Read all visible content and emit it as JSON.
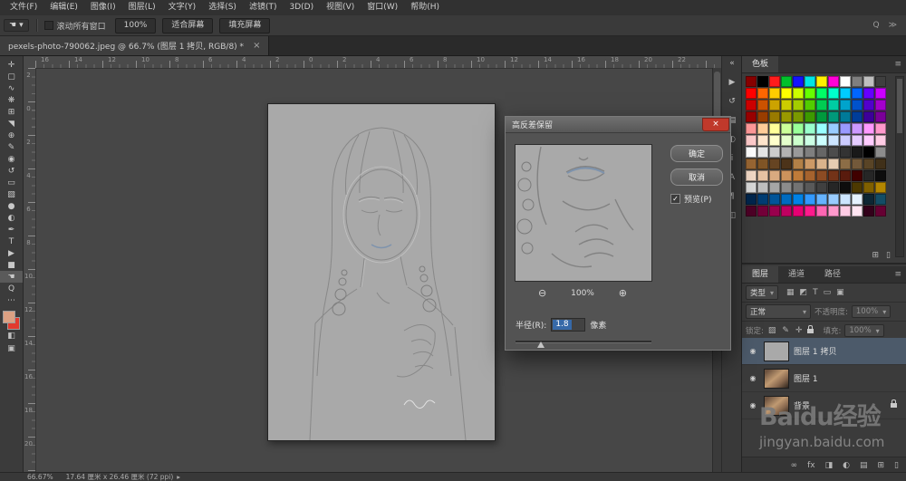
{
  "menu": {
    "items": [
      "文件(F)",
      "编辑(E)",
      "图像(I)",
      "图层(L)",
      "文字(Y)",
      "选择(S)",
      "滤镜(T)",
      "3D(D)",
      "视图(V)",
      "窗口(W)",
      "帮助(H)"
    ]
  },
  "options": {
    "scroll_all_label": "滚动所有窗口",
    "zoom_button": "100%",
    "fit_button": "适合屏幕",
    "fill_button": "填充屏幕"
  },
  "doc_tab": {
    "title": "pexels-photo-790062.jpeg @ 66.7% (图层 1 拷贝, RGB/8) *",
    "close_glyph": "×"
  },
  "tools": [
    {
      "name": "move-tool",
      "glyph": "✛"
    },
    {
      "name": "marquee-tool",
      "glyph": "▢"
    },
    {
      "name": "lasso-tool",
      "glyph": "∿"
    },
    {
      "name": "quick-selection-tool",
      "glyph": "❋"
    },
    {
      "name": "crop-tool",
      "glyph": "⊞"
    },
    {
      "name": "eyedropper-tool",
      "glyph": "◥"
    },
    {
      "name": "healing-brush-tool",
      "glyph": "⊕"
    },
    {
      "name": "brush-tool",
      "glyph": "✎"
    },
    {
      "name": "clone-stamp-tool",
      "glyph": "◉"
    },
    {
      "name": "history-brush-tool",
      "glyph": "↺"
    },
    {
      "name": "eraser-tool",
      "glyph": "▭"
    },
    {
      "name": "gradient-tool",
      "glyph": "▧"
    },
    {
      "name": "blur-tool",
      "glyph": "●"
    },
    {
      "name": "dodge-tool",
      "glyph": "◐"
    },
    {
      "name": "pen-tool",
      "glyph": "✒"
    },
    {
      "name": "type-tool",
      "glyph": "T"
    },
    {
      "name": "path-selection-tool",
      "glyph": "▶"
    },
    {
      "name": "shape-tool",
      "glyph": "■"
    },
    {
      "name": "hand-tool",
      "glyph": "☚",
      "active": true
    },
    {
      "name": "zoom-tool",
      "glyph": "Q"
    },
    {
      "name": "edit-toolbar-button",
      "glyph": "⋯"
    }
  ],
  "toolbar_colors": {
    "foreground": "#dca183",
    "background": "#e23a2e"
  },
  "toolbar_bottom": [
    {
      "name": "quick-mask-button",
      "glyph": "◧"
    },
    {
      "name": "screen-mode-button",
      "glyph": "▣"
    }
  ],
  "ruler": {
    "h_labels": [
      "16",
      "14",
      "12",
      "10",
      "8",
      "6",
      "4",
      "2",
      "0",
      "2",
      "4",
      "6",
      "8",
      "10",
      "12",
      "14",
      "16",
      "18",
      "20",
      "22"
    ],
    "v_labels": [
      "2",
      "0",
      "2",
      "4",
      "6",
      "8",
      "10",
      "12",
      "14",
      "16",
      "18",
      "20"
    ]
  },
  "dock_icons": [
    {
      "name": "dock-collapse-icon",
      "glyph": "«"
    },
    {
      "name": "dock-actions-icon",
      "glyph": "▶"
    },
    {
      "name": "dock-history-icon",
      "glyph": "↺"
    },
    {
      "name": "dock-styles-icon",
      "glyph": "▤"
    },
    {
      "name": "dock-adjustments-icon",
      "glyph": "◐"
    },
    {
      "name": "dock-info-icon",
      "glyph": "i"
    },
    {
      "name": "dock-character-icon",
      "glyph": "A"
    },
    {
      "name": "dock-paragraph-icon",
      "glyph": "¶"
    },
    {
      "name": "dock-clone-source-icon",
      "glyph": "◫"
    }
  ],
  "dialog": {
    "title": "高反差保留",
    "ok": "确定",
    "cancel": "取消",
    "preview_label": "预览(P)",
    "zoom_value": "100%",
    "radius_label": "半径(R):",
    "radius_value": "1.8",
    "radius_unit": "像素"
  },
  "swatches": {
    "tab": "色板",
    "colors": [
      "#870000",
      "#000000",
      "#ff1c1c",
      "#00c12b",
      "#1313ff",
      "#00e5e5",
      "#fff000",
      "#ff00d8",
      "#ffffff",
      "#7f7f7f",
      "#bfbfbf",
      "#3f3f3f",
      "#ff0000",
      "#ff6600",
      "#ffcc00",
      "#ffff00",
      "#ccff00",
      "#66ff00",
      "#00ff66",
      "#00ffcc",
      "#00ccff",
      "#0066ff",
      "#6600ff",
      "#cc00ff",
      "#cc0000",
      "#cc5200",
      "#cca300",
      "#cccc00",
      "#a3cc00",
      "#52cc00",
      "#00cc52",
      "#00cca3",
      "#00a3cc",
      "#0052cc",
      "#5200cc",
      "#a300cc",
      "#990000",
      "#993d00",
      "#997a00",
      "#999900",
      "#7a9900",
      "#3d9900",
      "#00993d",
      "#00997a",
      "#007a99",
      "#003d99",
      "#3d0099",
      "#7a0099",
      "#ff9999",
      "#ffcc99",
      "#ffff99",
      "#ccff99",
      "#99ff99",
      "#99ffcc",
      "#99ffff",
      "#99ccff",
      "#9999ff",
      "#cc99ff",
      "#ff99ff",
      "#ff99cc",
      "#ffcccc",
      "#ffe5cc",
      "#ffffcc",
      "#e5ffcc",
      "#ccffcc",
      "#ccffe5",
      "#ccffff",
      "#cce5ff",
      "#ccccff",
      "#e5ccff",
      "#ffccff",
      "#ffcce5",
      "#ffffff",
      "#e5e5e5",
      "#cccccc",
      "#b2b2b2",
      "#999999",
      "#7f7f7f",
      "#666666",
      "#4c4c4c",
      "#333333",
      "#191919",
      "#000000",
      "#8c8c8c",
      "#996633",
      "#805526",
      "#664422",
      "#4c3319",
      "#b28047",
      "#cc9966",
      "#d9b38c",
      "#e5ccb2",
      "#8c6d46",
      "#73593a",
      "#594426",
      "#403019",
      "#f2d9c6",
      "#e6c2a3",
      "#d9aa80",
      "#cc935c",
      "#bf7b39",
      "#a6632e",
      "#8c4b23",
      "#733318",
      "#591b0d",
      "#400000",
      "#262626",
      "#0d0d0d",
      "#d9d9d9",
      "#bfbfbf",
      "#a6a6a6",
      "#8c8c8c",
      "#737373",
      "#595959",
      "#404040",
      "#262626",
      "#0d0d0d",
      "#4d3900",
      "#806000",
      "#b38600",
      "#00264d",
      "#003d73",
      "#005499",
      "#006bbf",
      "#0082e6",
      "#3399ff",
      "#66b3ff",
      "#99ccff",
      "#cce5ff",
      "#e5f2ff",
      "#0d2633",
      "#134d66",
      "#4d0026",
      "#730039",
      "#99004d",
      "#bf0060",
      "#e60073",
      "#ff1a8c",
      "#ff66b3",
      "#ff99cc",
      "#ffcce5",
      "#ffe5f2",
      "#33001a",
      "#660033"
    ]
  },
  "layers_panel": {
    "tabs": [
      "图层",
      "通道",
      "路径"
    ],
    "filter_label": "类型",
    "filter_icons": [
      {
        "name": "filter-pixel-layers-icon",
        "glyph": "▦"
      },
      {
        "name": "filter-adjustment-layers-icon",
        "glyph": "◩"
      },
      {
        "name": "filter-type-layers-icon",
        "glyph": "T"
      },
      {
        "name": "filter-shape-layers-icon",
        "glyph": "▭"
      },
      {
        "name": "filter-smart-objects-icon",
        "glyph": "▣"
      }
    ],
    "blend_mode": "正常",
    "opacity_label": "不透明度:",
    "opacity_value": "100%",
    "lock_label": "锁定:",
    "lock_icons": [
      {
        "name": "lock-transparency-icon",
        "glyph": "▨"
      },
      {
        "name": "lock-pixels-icon",
        "glyph": "✎"
      },
      {
        "name": "lock-position-icon",
        "glyph": "✛"
      },
      {
        "name": "lock-all-icon",
        "glyph": "",
        "css": "css-lock"
      }
    ],
    "fill_label": "填充:",
    "fill_value": "100%",
    "layers": [
      {
        "name": "图层 1 拷贝"
      },
      {
        "name": "图层 1"
      },
      {
        "name": "背景"
      }
    ],
    "bottom_icons": [
      {
        "name": "link-layers-icon",
        "glyph": "∞"
      },
      {
        "name": "layer-effects-icon",
        "glyph": "fx"
      },
      {
        "name": "layer-mask-icon",
        "glyph": "◨"
      },
      {
        "name": "adjustment-layer-icon",
        "glyph": "◐"
      },
      {
        "name": "layer-group-icon",
        "glyph": "▤"
      },
      {
        "name": "new-layer-icon",
        "glyph": "⊞"
      },
      {
        "name": "delete-layer-icon",
        "glyph": "▯"
      }
    ]
  },
  "watermark": {
    "title": "Baidu经验",
    "url": "jingyan.baidu.com"
  },
  "status": {
    "zoom": "66.67%",
    "doc_info": "17.64 厘米 x 26.46 厘米 (72 ppi)"
  },
  "icons": {
    "eye": "◉",
    "dropdown": "▾",
    "check": "✓",
    "menu": "≡",
    "search": "Q",
    "chevrons": "≫",
    "swatch_new": "⊞",
    "swatch_delete": "▯",
    "zoom_out": "⊖",
    "zoom_in": "⊕",
    "status_arrow": "▸",
    "hand": "☚"
  }
}
